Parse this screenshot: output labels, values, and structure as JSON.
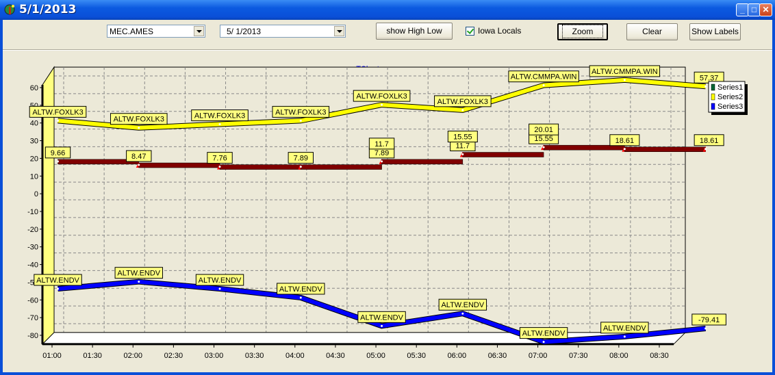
{
  "window": {
    "title": "5/1/2013",
    "minimize": "_",
    "maximize": "□",
    "close": "✕"
  },
  "toolbar": {
    "station_select": {
      "value": "MEC.AMES"
    },
    "date_select": {
      "value": "5/  1/2013"
    },
    "show_high_low_label": "show High Low",
    "iowa_locals_label": "Iowa Locals",
    "iowa_locals_checked": true,
    "zoom_label": "Zoom",
    "clear_label": "Clear",
    "show_labels_label": "Show Labels"
  },
  "chart_data": {
    "type": "line",
    "title": "TChart",
    "xlabel": "",
    "ylabel": "",
    "ylim": [
      -85,
      65
    ],
    "yticks": [
      60,
      50,
      40,
      30,
      20,
      10,
      0,
      -10,
      -20,
      -30,
      -40,
      -50,
      -60,
      -70,
      -80
    ],
    "x_tick_labels": [
      "01:00",
      "01:30",
      "02:00",
      "02:30",
      "03:00",
      "03:30",
      "04:00",
      "04:30",
      "05:00",
      "05:30",
      "06:00",
      "06:30",
      "07:00",
      "07:30",
      "08:00",
      "08:30"
    ],
    "x": [
      "01:00",
      "02:00",
      "03:00",
      "04:00",
      "05:00",
      "06:00",
      "07:00",
      "08:00",
      "09:00"
    ],
    "grid": true,
    "legend": {
      "position": "top-right",
      "entries": [
        {
          "name": "Series1",
          "color": "#006633"
        },
        {
          "name": "Series2",
          "color": "#ffff00"
        },
        {
          "name": "Series3",
          "color": "#0000ff"
        }
      ]
    },
    "series": [
      {
        "name": "Series1",
        "style": "step",
        "color": "#800000",
        "values": [
          15,
          13,
          12,
          12,
          15,
          19,
          23,
          22,
          22
        ],
        "labels": [
          "9.66",
          "8.47",
          "7.76",
          "7.89",
          "7.89",
          "11.7",
          "15.55",
          "18.61",
          "18.61"
        ],
        "stacked_labels": [
          "",
          "",
          "",
          "",
          "11.7",
          "15.55",
          "20.01",
          "",
          ""
        ]
      },
      {
        "name": "Series2",
        "style": "line",
        "color": "#ffff00",
        "values": [
          38,
          34,
          36,
          38,
          47,
          44,
          58,
          61,
          57.37
        ],
        "labels": [
          "ALTW.FOXLK3",
          "ALTW.FOXLK3",
          "ALTW.FOXLK3",
          "ALTW.FOXLK3",
          "ALTW.FOXLK3",
          "ALTW.FOXLK3",
          "ALTW.CMMPA.WIN",
          "ALTW.CMMPA.WIN",
          "57.37"
        ]
      },
      {
        "name": "Series3",
        "style": "line",
        "color": "#0000ff",
        "values": [
          -57,
          -53,
          -57,
          -62,
          -78,
          -71,
          -87,
          -84,
          -79.41
        ],
        "labels": [
          "ALTW.ENDV",
          "ALTW.ENDV",
          "ALTW.ENDV",
          "ALTW.ENDV",
          "ALTW.ENDV",
          "ALTW.ENDV",
          "ALTW.ENDV",
          "ALTW.ENDV",
          "-79.41"
        ]
      }
    ]
  }
}
